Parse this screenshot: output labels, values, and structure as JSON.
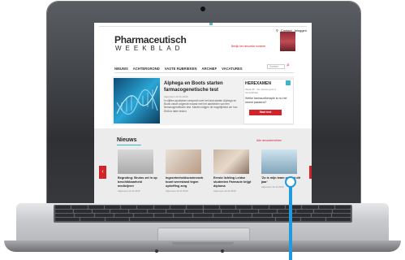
{
  "site": {
    "top_links": [
      "Contact",
      "Inloggen"
    ],
    "logo_line1": "Pharmaceutisch",
    "logo_line2": "WEEKBLAD",
    "subscribe_link": "Bekijk het nieuwste nummer",
    "nav": [
      "NIEUWS",
      "ACHTERGROND",
      "VASTE RUBRIEKEN",
      "ARCHIEF",
      "VACATURES"
    ],
    "search_placeholder": "Zoeken",
    "hero": {
      "title": "Alphega en Boots starten farmacogenetische test",
      "meta": "Algemeen  12-11-2019",
      "text": "In vijftien apotheken verspreid over het land starten Alphega en Boots vanaf volgende maand met het aanbieden van een farmacogenetische test. Klanten krijgen de mogelijkheid om hun DNA te laten testen."
    },
    "exam": {
      "title": "HEREXAMEN",
      "subtitle": "Week 45 · De nieuwe quiz is beschikbaar",
      "question": "Welke farmacotherapie is nu het meest passend?",
      "button": "Start test"
    },
    "news": {
      "heading": "Nieuws",
      "all_link": "Alle nieuwsberichten",
      "cards": [
        {
          "title": "Begroting: Bruins zet in op beschikbaarheid medicijnen",
          "meta": "Algemeen  12-11-2019"
        },
        {
          "title": "Ingezetenheidsonderzoek toont weerstand tegen opheffing zorg",
          "meta": "Algemeen  12-11-2019"
        },
        {
          "title": "Eerste lichting Leidse studenten Farmacie krijgt diploma",
          "meta": "Algemeen  12-11-2019"
        },
        {
          "title": "'Zo is mijn team gestart dit jaar'",
          "meta": "Algemeen  12-11-2019"
        }
      ]
    }
  }
}
